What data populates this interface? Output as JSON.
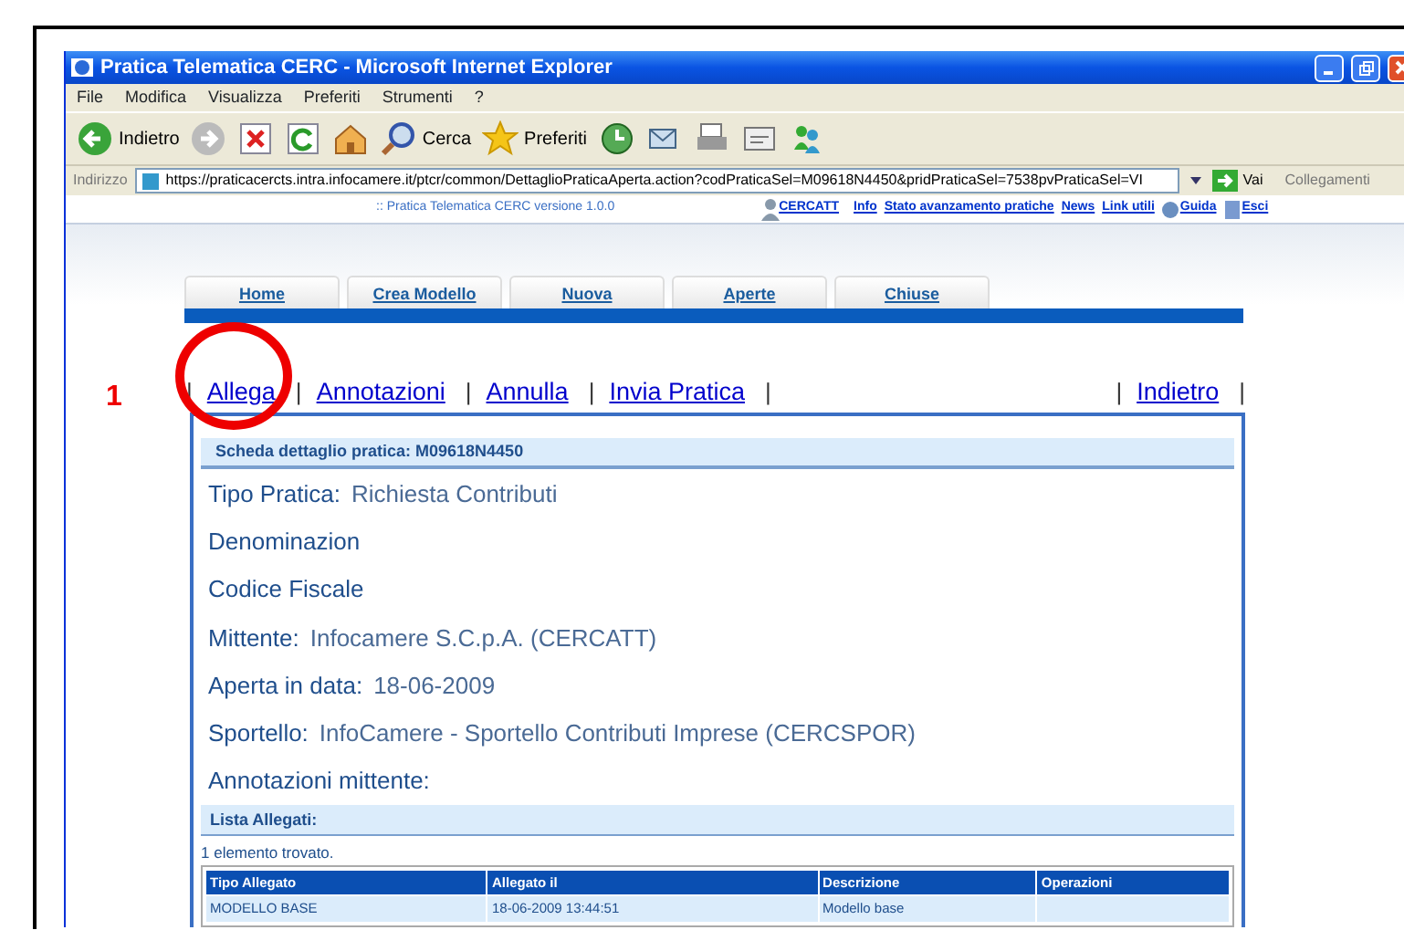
{
  "annotation": {
    "number": "1"
  },
  "window": {
    "title": "Pratica Telematica CERC - Microsoft Internet Explorer"
  },
  "menu": [
    "File",
    "Modifica",
    "Visualizza",
    "Preferiti",
    "Strumenti",
    "?"
  ],
  "toolbar": [
    {
      "kind": "back",
      "label": "Indietro"
    },
    {
      "kind": "forward"
    },
    {
      "kind": "stop"
    },
    {
      "kind": "refresh"
    },
    {
      "kind": "home"
    },
    {
      "kind": "search",
      "label": "Cerca"
    },
    {
      "kind": "favorites",
      "label": "Preferiti"
    },
    {
      "kind": "history"
    },
    {
      "kind": "mail"
    },
    {
      "kind": "print"
    },
    {
      "kind": "edit"
    },
    {
      "kind": "messenger"
    }
  ],
  "address_bar": {
    "label": "Indirizzo",
    "value": "https://praticacercts.intra.infocamere.it/ptcr/common/DettaglioPraticaAperta.action?codPraticaSel=M09618N4450&pridPraticaSel=7538pvPraticaSel=VI",
    "go": "Vai",
    "links": "Collegamenti"
  },
  "site_header": {
    "version": ":: Pratica Telematica CERC versione 1.0.0",
    "user": "CERCATT",
    "links": [
      {
        "label": "Info"
      },
      {
        "label": "Stato avanzamento pratiche"
      },
      {
        "label": "News"
      },
      {
        "label": "Link utili"
      },
      {
        "label": "Guida"
      },
      {
        "label": "Esci"
      }
    ]
  },
  "tabs": [
    "Home",
    "Crea Modello",
    "Nuova",
    "Aperte",
    "Chiuse"
  ],
  "actions": [
    {
      "kind": "separator",
      "text": "|"
    },
    {
      "kind": "link",
      "text": "Allega"
    },
    {
      "kind": "separator",
      "text": "|"
    },
    {
      "kind": "link",
      "text": "Annotazioni"
    },
    {
      "kind": "separator",
      "text": "|"
    },
    {
      "kind": "link",
      "text": "Annulla"
    },
    {
      "kind": "separator",
      "text": "|"
    },
    {
      "kind": "link",
      "text": "Invia Pratica"
    },
    {
      "kind": "separator",
      "text": "|"
    },
    {
      "kind": "spacer"
    },
    {
      "kind": "separator",
      "text": "|"
    },
    {
      "kind": "link",
      "text": "Indietro"
    },
    {
      "kind": "separator",
      "text": "|"
    }
  ],
  "detail": {
    "title": "Scheda dettaglio pratica: M09618N4450",
    "fields": [
      {
        "label": "Tipo Pratica:",
        "value": "Richiesta Contributi"
      },
      {
        "label": "Denominazion"
      },
      {
        "label": "Codice Fiscale"
      },
      {
        "label": "Mittente:",
        "value": "Infocamere S.C.p.A. (CERCATT)"
      },
      {
        "label": "Aperta in data:",
        "value": "18-06-2009"
      },
      {
        "label": "Sportello:",
        "value": "InfoCamere - Sportello Contributi Imprese (CERCSPOR)"
      },
      {
        "label": "Annotazioni mittente:"
      }
    ]
  },
  "attachments": {
    "title": "Lista Allegati:",
    "count": "1 elemento trovato.",
    "columns": [
      "Tipo Allegato",
      "Allegato il",
      "Descrizione",
      "Operazioni"
    ],
    "rows": [
      [
        "MODELLO BASE",
        "18-06-2009 13:44:51",
        "Modello base"
      ]
    ]
  }
}
